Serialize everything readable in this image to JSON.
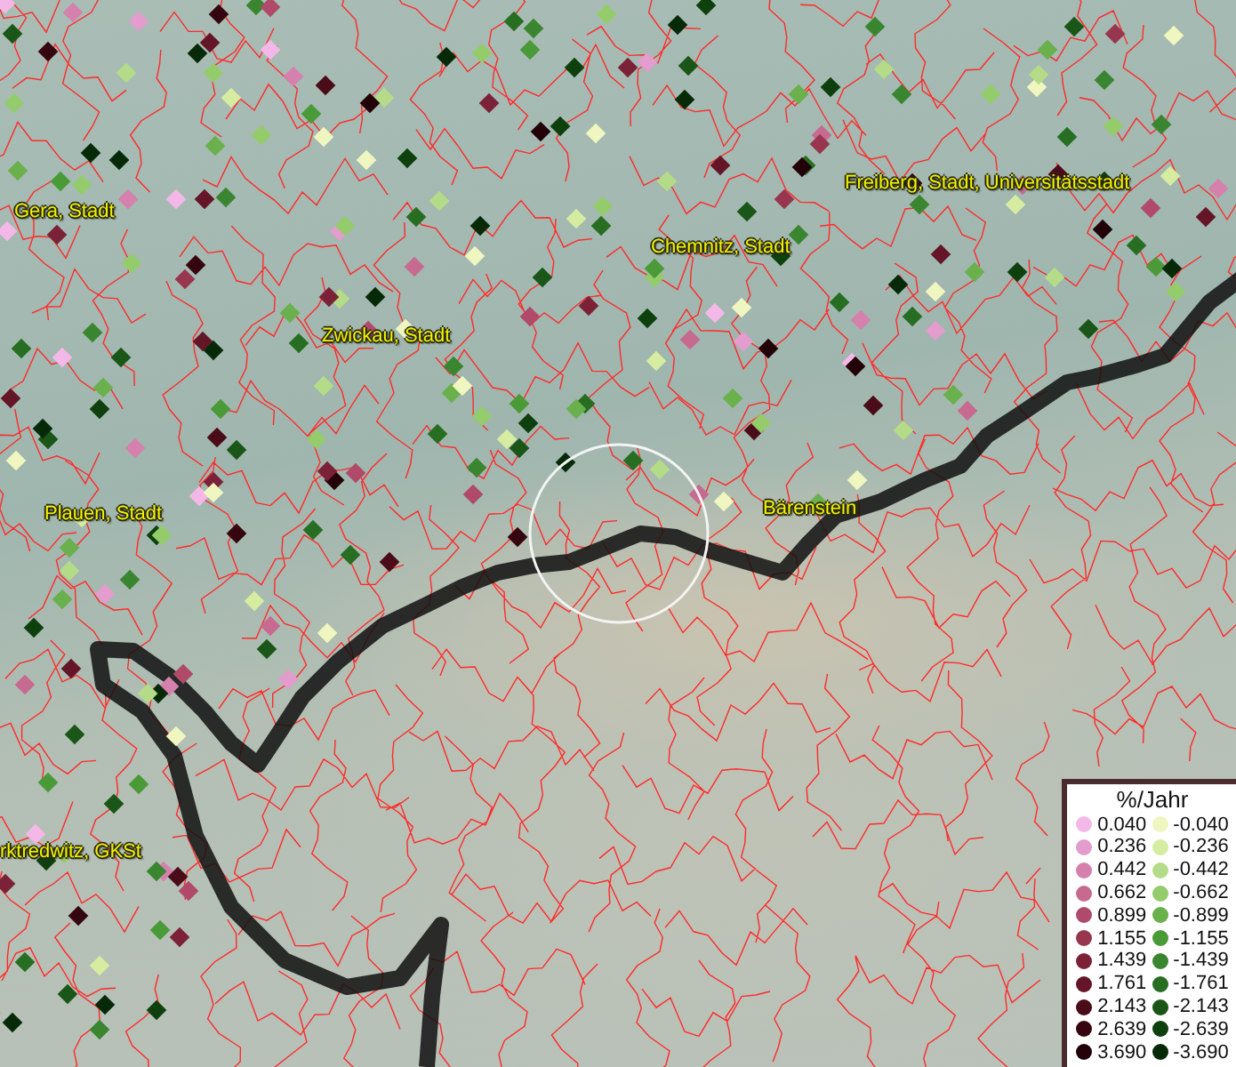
{
  "map": {
    "place_labels": [
      {
        "text": "Gera, Stadt"
      },
      {
        "text": "Freiberg, Stadt, Universitätsstadt"
      },
      {
        "text": "Chemnitz, Stadt"
      },
      {
        "text": "Zwickau, Stadt"
      },
      {
        "text": "Plauen, Stadt"
      },
      {
        "text": "Bärenstein"
      },
      {
        "text": "rktredwitz, GKSt"
      }
    ]
  },
  "legend": {
    "title": "%/Jahr",
    "positive": [
      {
        "label": "0.040",
        "color": "#f4b8e8"
      },
      {
        "label": "0.236",
        "color": "#e39ccd"
      },
      {
        "label": "0.442",
        "color": "#d580ad"
      },
      {
        "label": "0.662",
        "color": "#c76a90"
      },
      {
        "label": "0.899",
        "color": "#b04a6a"
      },
      {
        "label": "1.155",
        "color": "#98364f"
      },
      {
        "label": "1.439",
        "color": "#7c2238"
      },
      {
        "label": "1.761",
        "color": "#641628"
      },
      {
        "label": "2.143",
        "color": "#4a0c18"
      },
      {
        "label": "2.639",
        "color": "#360610"
      },
      {
        "label": "3.690",
        "color": "#220208"
      }
    ],
    "negative": [
      {
        "label": "-0.040",
        "color": "#f0f6c0"
      },
      {
        "label": "-0.236",
        "color": "#d6eca0"
      },
      {
        "label": "-0.442",
        "color": "#b4dc88"
      },
      {
        "label": "-0.662",
        "color": "#94cc6c"
      },
      {
        "label": "-0.899",
        "color": "#6ab04c"
      },
      {
        "label": "-1.155",
        "color": "#4a9a38"
      },
      {
        "label": "-1.439",
        "color": "#3a8630"
      },
      {
        "label": "-1.761",
        "color": "#286e22"
      },
      {
        "label": "-2.143",
        "color": "#1a5618"
      },
      {
        "label": "-2.639",
        "color": "#0e400e"
      },
      {
        "label": "-3.690",
        "color": "#062a08"
      }
    ]
  }
}
